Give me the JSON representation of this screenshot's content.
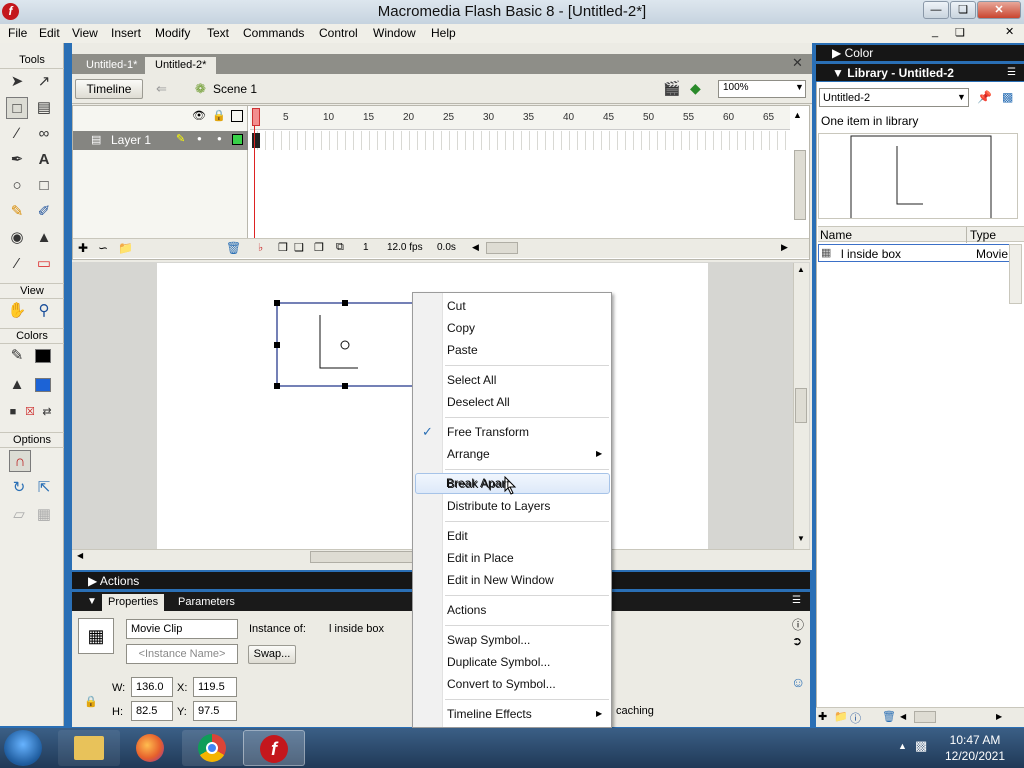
{
  "window": {
    "title": "Macromedia Flash Basic 8 - [Untitled-2*]",
    "app_icon": "f"
  },
  "menubar": [
    "File",
    "Edit",
    "View",
    "Insert",
    "Modify",
    "Text",
    "Commands",
    "Control",
    "Window",
    "Help"
  ],
  "tools": {
    "title": "Tools",
    "view": "View",
    "colors": "Colors",
    "options": "Options"
  },
  "doc_tabs": [
    "Untitled-1*",
    "Untitled-2*"
  ],
  "scene": {
    "timeline_btn": "Timeline",
    "scene_name": "Scene 1",
    "zoom": "100%"
  },
  "timeline": {
    "layer_name": "Layer 1",
    "ruler": [
      "5",
      "10",
      "15",
      "20",
      "25",
      "30",
      "35",
      "40",
      "45",
      "50",
      "55",
      "60",
      "65"
    ],
    "frame": "1",
    "fps": "12.0 fps",
    "time": "0.0s"
  },
  "panels": {
    "actions": "Actions",
    "properties_tab": "Properties",
    "parameters_tab": "Parameters",
    "symbol_type": "Movie Clip",
    "instance_placeholder": "<Instance Name>",
    "instance_of_label": "Instance of:",
    "instance_of": "l inside box",
    "swap_btn": "Swap...",
    "w_label": "W:",
    "w": "136.0",
    "x_label": "X:",
    "x": "119.5",
    "h_label": "H:",
    "h": "82.5",
    "y_label": "Y:",
    "y": "97.5",
    "caching": "caching"
  },
  "library": {
    "color_title": "Color",
    "title": "Library - Untitled-2",
    "doc": "Untitled-2",
    "count": "One item in library",
    "col_name": "Name",
    "col_type": "Type",
    "item_name": "l inside box",
    "item_type": "Movie"
  },
  "context_menu": {
    "cut": "Cut",
    "copy": "Copy",
    "paste": "Paste",
    "select_all": "Select All",
    "deselect_all": "Deselect All",
    "free_transform": "Free Transform",
    "arrange": "Arrange",
    "break_apart": "Break Apart",
    "distribute": "Distribute to Layers",
    "edit": "Edit",
    "edit_in_place": "Edit in Place",
    "edit_new_window": "Edit in New Window",
    "actions": "Actions",
    "swap_symbol": "Swap Symbol...",
    "duplicate_symbol": "Duplicate Symbol...",
    "convert_symbol": "Convert to Symbol...",
    "timeline_effects": "Timeline Effects"
  },
  "taskbar": {
    "time": "10:47 AM",
    "date": "12/20/2021"
  }
}
